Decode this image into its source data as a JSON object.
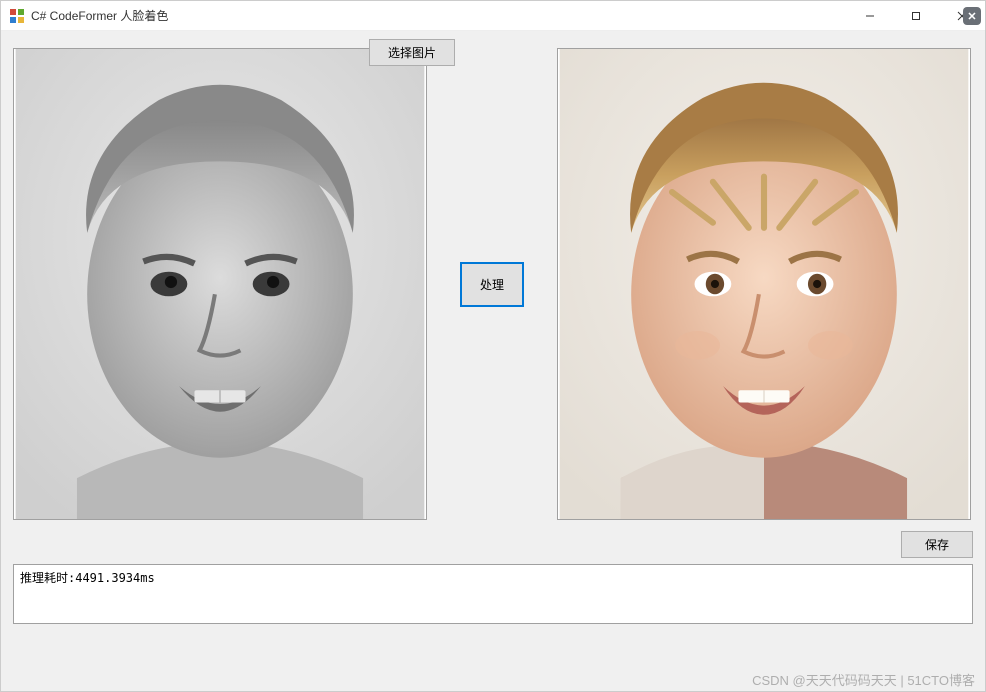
{
  "window": {
    "title": "C# CodeFormer 人脸着色"
  },
  "buttons": {
    "select_image": "选择图片",
    "process": "处理",
    "save": "保存"
  },
  "log": {
    "text": "推理耗时:4491.3934ms"
  },
  "watermark": "CSDN @天天代码码天天 | 51CTO博客",
  "images": {
    "left_alt": "input-grayscale-face",
    "right_alt": "output-colorized-face"
  }
}
